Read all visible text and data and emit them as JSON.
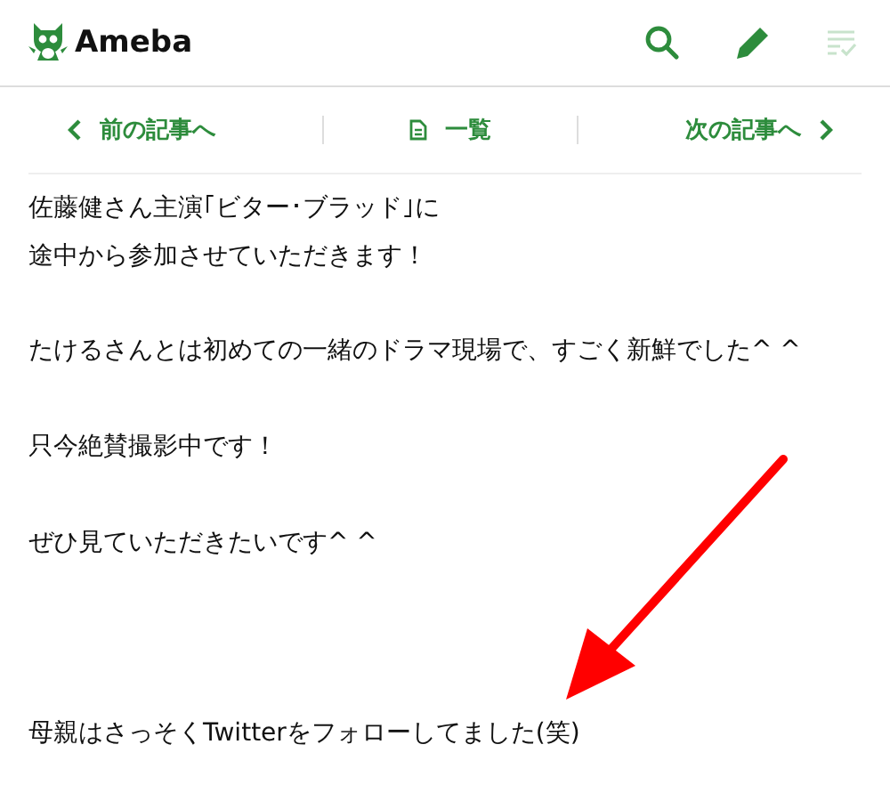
{
  "header": {
    "logo_text": "Ameba"
  },
  "nav": [
    {
      "kind": "prev",
      "label": "前の記事へ"
    },
    {
      "kind": "list",
      "label": "一覧"
    },
    {
      "kind": "next",
      "label": "次の記事へ"
    }
  ],
  "post": [
    {
      "kind": "text",
      "text": "佐藤健さん主演｢ビター･ブラッド｣に"
    },
    {
      "kind": "text",
      "text": "途中から参加させていただきます！"
    },
    {
      "kind": "break"
    },
    {
      "kind": "text",
      "text": "たけるさんとは初めての一緒のドラマ現場で、すごく新鮮でした^ ^"
    },
    {
      "kind": "break"
    },
    {
      "kind": "text",
      "text": "只今絶賛撮影中です！"
    },
    {
      "kind": "break"
    },
    {
      "kind": "text",
      "text": "ぜひ見ていただきたいです^ ^"
    },
    {
      "kind": "break"
    },
    {
      "kind": "break"
    },
    {
      "kind": "break"
    },
    {
      "kind": "text",
      "text": "母親はさっそくTwitterをフォローしてました(笑)"
    }
  ]
}
